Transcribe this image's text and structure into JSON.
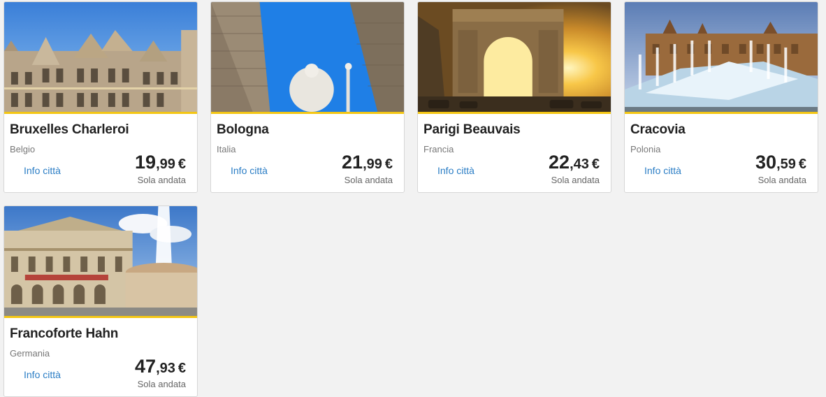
{
  "cards": [
    {
      "city": "Bruxelles Charleroi",
      "country": "Belgio",
      "info": "Info città",
      "price_int": "19",
      "price_dec": ",99",
      "currency": "€",
      "fare_type": "Sola andata"
    },
    {
      "city": "Bologna",
      "country": "Italia",
      "info": "Info città",
      "price_int": "21",
      "price_dec": ",99",
      "currency": "€",
      "fare_type": "Sola andata"
    },
    {
      "city": "Parigi Beauvais",
      "country": "Francia",
      "info": "Info città",
      "price_int": "22",
      "price_dec": ",43",
      "currency": "€",
      "fare_type": "Sola andata"
    },
    {
      "city": "Cracovia",
      "country": "Polonia",
      "info": "Info città",
      "price_int": "30",
      "price_dec": ",59",
      "currency": "€",
      "fare_type": "Sola andata"
    },
    {
      "city": "Francoforte Hahn",
      "country": "Germania",
      "info": "Info città",
      "price_int": "47",
      "price_dec": ",93",
      "currency": "€",
      "fare_type": "Sola andata"
    }
  ],
  "colors": {
    "accent": "#f3c614",
    "link": "#2a7dc5",
    "background": "#f2f2f2"
  }
}
